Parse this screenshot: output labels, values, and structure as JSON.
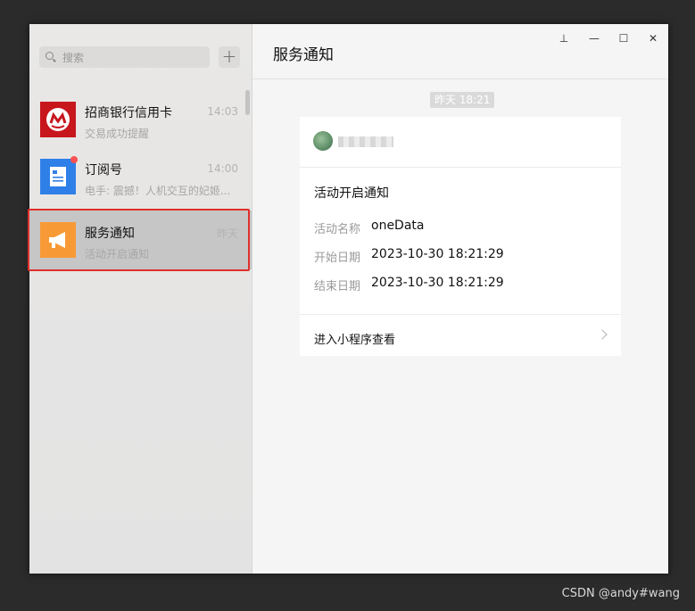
{
  "sidebar": {
    "search_placeholder": "搜索",
    "add_label": "+",
    "chats": [
      {
        "name": "招商银行信用卡",
        "time": "14:03",
        "preview": "交易成功提醒"
      },
      {
        "name": "订阅号",
        "time": "14:00",
        "preview": "电手: 震撼！人机交互的妃姬...",
        "unread": true
      },
      {
        "name": "服务通知",
        "time": "昨天",
        "preview": "活动开启通知",
        "selected": true
      }
    ]
  },
  "main": {
    "title": "服务通知",
    "window_controls": {
      "pin": "⊥",
      "minimize": "—",
      "maximize": "☐",
      "close": "✕"
    },
    "time_divider": "昨天 18:21",
    "card": {
      "title": "活动开启通知",
      "fields": [
        {
          "label": "活动名称",
          "value": "oneData"
        },
        {
          "label": "开始日期",
          "value": "2023-10-30 18:21:29"
        },
        {
          "label": "结束日期",
          "value": "2023-10-30 18:21:29"
        }
      ],
      "footer_link": "进入小程序查看"
    }
  },
  "watermark": "CSDN @andy#wang",
  "colors": {
    "accent_red": "#fa5151",
    "selection_outline": "#e0302a",
    "bank_red": "#c8161d",
    "subscription_blue": "#2f7fe8",
    "service_orange": "#f79a36"
  }
}
